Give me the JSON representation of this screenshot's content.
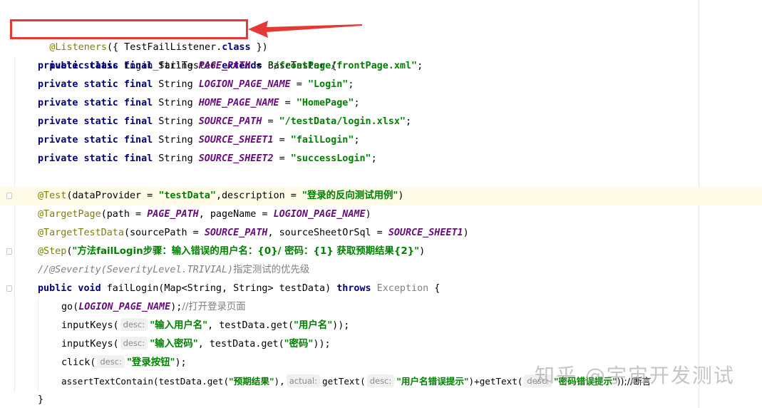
{
  "editor": {
    "lines": {
      "l1": {
        "ann": "@Listeners",
        "rest": "({ TestFailListener.",
        "kw": "class",
        "end": " })"
      },
      "l2": {
        "kw1": "public class",
        "mid": " Login_failTester ",
        "kw2": "extends",
        "end": " BaseTester {"
      },
      "l3": {
        "mods": "private static final",
        "type": " String ",
        "name": "PAGE_PATH",
        "eq": " = ",
        "val": "\"/frontPage/frontPage.xml\"",
        "end": ";"
      },
      "l4": {
        "mods": "private static final",
        "type": " String ",
        "name": "LOGION_PAGE_NAME",
        "eq": " = ",
        "val": "\"Login\"",
        "end": ";"
      },
      "l5": {
        "mods": "private static final",
        "type": " String ",
        "name": "HOME_PAGE_NAME",
        "eq": " = ",
        "val": "\"HomePage\"",
        "end": ";"
      },
      "l6": {
        "mods": "private static final",
        "type": " String ",
        "name": "SOURCE_PATH",
        "eq": " = ",
        "val": "\"/testData/login.xlsx\"",
        "end": ";"
      },
      "l7": {
        "mods": "private static final",
        "type": " String ",
        "name": "SOURCE_SHEET1",
        "eq": " = ",
        "val": "\"failLogin\"",
        "end": ";"
      },
      "l8": {
        "mods": "private static final",
        "type": " String ",
        "name": "SOURCE_SHEET2",
        "eq": " = ",
        "val": "\"successLogin\"",
        "end": ";"
      },
      "l10": {
        "ann": "@Test",
        "a": "(dataProvider = ",
        "s1": "\"testData\"",
        "b": ",description = ",
        "s2": "\"登录的反向测试用例\"",
        "end": ")"
      },
      "l11": {
        "ann": "@TargetPage",
        "a": "(path = ",
        "c1": "PAGE_PATH",
        "b": ", pageName = ",
        "c2": "LOGION_PAGE_NAME",
        "end": ")"
      },
      "l12": {
        "ann": "@TargetTestData",
        "a": "(sourcePath = ",
        "c1": "SOURCE_PATH",
        "b": ", sourceSheetOrSql = ",
        "c2": "SOURCE_SHEET1",
        "end": ")"
      },
      "l13": {
        "ann": "@Step",
        "a": "(",
        "s1": "\"方法failLogin步骤：输入错误的用户名：{0}/ 密码：{1} 获取预期结果{2}\"",
        "end": ")"
      },
      "l14": {
        "cmt": "//@Severity(SeverityLevel.TRIVIAL)",
        "cmt_cn": "指定测试的优先级"
      },
      "l15": {
        "kw1": "public void",
        "a": " failLogin(Map<String, String> testData) ",
        "kw2": "throws",
        "exc": " Exception",
        "end": " {"
      },
      "l16": {
        "a": "go(",
        "c1": "LOGION_PAGE_NAME",
        "b": ");",
        "cmt": "//打开登录页面"
      },
      "l17": {
        "a": "inputKeys(",
        "hint": "desc:",
        "s1": "\"输入用户名\"",
        "b": ", testData.get(",
        "s2": "\"用户名\"",
        "end": "));"
      },
      "l18": {
        "a": "inputKeys(",
        "hint": "desc:",
        "s1": "\"输入密码\"",
        "b": ", testData.get(",
        "s2": "\"密码\"",
        "end": "));"
      },
      "l19": {
        "a": "click(",
        "hint": "desc:",
        "s1": "\"登录按钮\"",
        "end": ");"
      },
      "l20": {
        "a": "assertTextContain(testData.get(",
        "s1": "\"预期结果\"",
        "b": "),",
        "hint1": "actual:",
        "c": "getText(",
        "hint2": "desc:",
        "s2": "\"用户名错误提示\"",
        "d": ")+getText(",
        "hint3": "desc:",
        "s3": "\"密码错误提示\"",
        "end": "));//断言"
      },
      "l21": {
        "end": "}"
      }
    }
  },
  "watermark": "知乎 @宇宙开发测试",
  "colors": {
    "keyword": "#000080",
    "annotation": "#808000",
    "constant": "#660e7a",
    "string": "#008000",
    "comment": "#808080",
    "highlight": "#e53935",
    "current_line": "#fdfbe6"
  }
}
